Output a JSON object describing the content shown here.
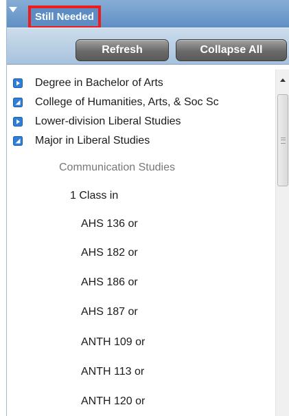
{
  "header": {
    "title": "Still Needed",
    "arrow_icon": "collapse-triangle-icon",
    "background": "#6d9acc",
    "highlight_border": "#ee1d1d"
  },
  "toolbar": {
    "refresh_label": "Refresh",
    "collapse_label": "Collapse All"
  },
  "tree": {
    "items": [
      {
        "label": "Degree in Bachelor of Arts",
        "icon": "expand-icon"
      },
      {
        "label": "College of Humanities, Arts, & Soc Sc",
        "icon": "collapse-icon"
      },
      {
        "label": "Lower-division Liberal Studies",
        "icon": "expand-icon"
      },
      {
        "label": "Major in Liberal Studies",
        "icon": "collapse-icon"
      }
    ],
    "group_label": "Communication Studies",
    "requirement": "1 Class in",
    "courses": [
      "AHS 136 or",
      "AHS 182 or",
      "AHS 186 or",
      "AHS 187 or",
      "ANTH 109 or",
      "ANTH 113 or",
      "ANTH 120 or"
    ]
  },
  "scrollbar": {
    "up_icon": "scroll-up-arrow-icon"
  }
}
